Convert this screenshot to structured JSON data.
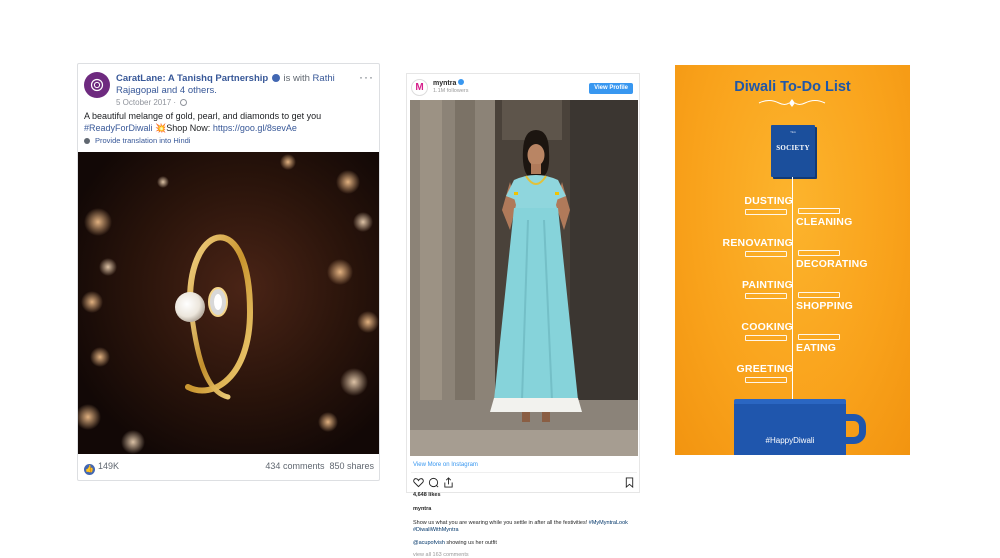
{
  "facebook": {
    "page_name": "CaratLane: A Tanishq Partnership",
    "with_text": "is with",
    "tagged": "Rathi Rajagopal",
    "and_others": "and 4 others.",
    "date": "5 October 2017 ·",
    "more": "···",
    "text_line1": "A beautiful melange of gold, pearl, and diamonds to get you",
    "hashtag": "#ReadyForDiwali",
    "emoji": "💥",
    "shop_now": "Shop Now:",
    "link": "https://goo.gl/8sevAe",
    "translate": "Provide translation into Hindi",
    "likes": "149K",
    "comments": "434 comments",
    "shares": "850 shares",
    "colors": {
      "link": "#385898",
      "avatar": "#6e2a7f"
    }
  },
  "instagram": {
    "username": "myntra",
    "avatar_letter": "M",
    "followers": "1.1M followers",
    "view_profile": "View Profile",
    "view_more": "View More on Instagram",
    "likes": "4,648 likes",
    "caption_user": "myntra",
    "caption": "Show us what you are wearing while you settle in after all the festivities!",
    "caption_tags": "#MyMyntraLook #DiwaliWithMyntra",
    "comment_mention": "@acupofvish",
    "comment_text": "showing us her outfit",
    "view_all": "view all 163 comments",
    "icons": [
      "heart-icon",
      "comment-icon",
      "share-icon",
      "bookmark-icon"
    ],
    "colors": {
      "accent": "#3897f0"
    }
  },
  "poster": {
    "title": "Diwali To-Do List",
    "book_label": "SOCIETY",
    "book_sub": "TEA",
    "items_left": [
      "DUSTING",
      "RENOVATING",
      "PAINTING",
      "COOKING",
      "GREETING"
    ],
    "items_right": [
      "CLEANING",
      "DECORATING",
      "SHOPPING",
      "EATING"
    ],
    "mug_text": "#HappyDiwali",
    "colors": {
      "background": "#f9a21b",
      "blue": "#1f57a8"
    }
  }
}
